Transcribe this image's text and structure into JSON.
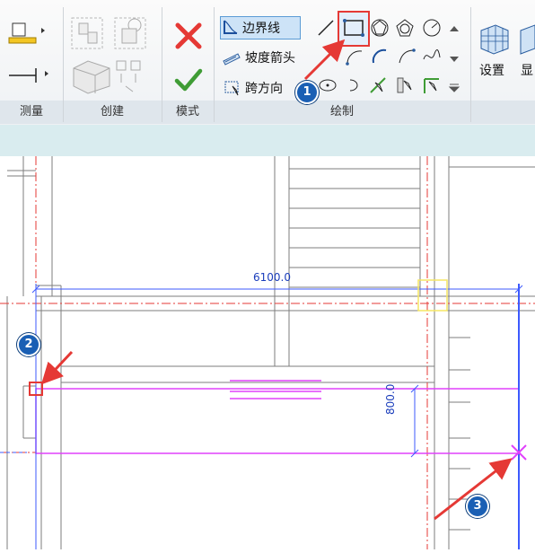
{
  "ribbon": {
    "panels": {
      "measure": "测量",
      "create": "创建",
      "mode": "模式",
      "draw": "绘制"
    },
    "tools": {
      "boundary_line": "边界线",
      "slope_arrow": "坡度箭头",
      "span_direction": "跨方向"
    },
    "settings_label": "设置",
    "show_label_partial": "显"
  },
  "canvas": {
    "dim_horizontal": "6100.0",
    "dim_vertical": "800.0"
  },
  "callouts": [
    "1",
    "2",
    "3"
  ],
  "colors": {
    "accent_red": "#e53935",
    "callout_blue": "#1a5fb4",
    "boundary_magenta": "#e040fb",
    "dimension_blue": "#3d5afe",
    "ref_red": "#e53935"
  }
}
